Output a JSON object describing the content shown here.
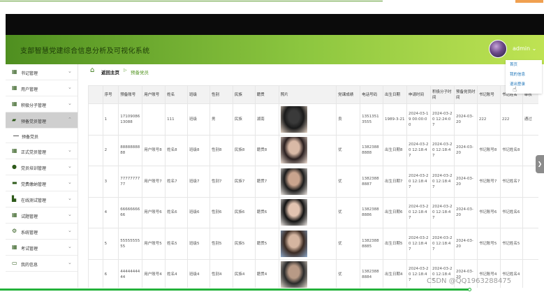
{
  "app": {
    "title": "支部智慧党建综合信息分析及可视化系统",
    "user": "admin ⌄"
  },
  "user_menu": [
    "首页",
    "我的信息",
    "退出登录"
  ],
  "sidebar": {
    "items": [
      {
        "label": "书记管理",
        "icon": "grid-icon"
      },
      {
        "label": "用户管理",
        "icon": "grid-icon"
      },
      {
        "label": "积极分子管理",
        "icon": "grid-icon"
      },
      {
        "label": "预备党员管理",
        "icon": "chat-icon",
        "active": true
      },
      {
        "label": "正式党员管理",
        "icon": "grid-icon"
      },
      {
        "label": "党员培训管理",
        "icon": "person-icon"
      },
      {
        "label": "党费缴纳管理",
        "icon": "monitor-icon"
      },
      {
        "label": "在线测试管理",
        "icon": "chart-icon"
      },
      {
        "label": "试题管理",
        "icon": "grid-icon"
      },
      {
        "label": "系统管理",
        "icon": "gear-icon"
      },
      {
        "label": "考试管理",
        "icon": "grid-icon"
      },
      {
        "label": "我的信息",
        "icon": "card-icon"
      }
    ],
    "submenu": "预备党员"
  },
  "breadcrumb": {
    "home": "返回主页",
    "current": "预备党员"
  },
  "table": {
    "headers": [
      "",
      "序号",
      "预备账号",
      "用户账号",
      "姓名",
      "班级",
      "性别",
      "民族",
      "籍贯",
      "照片",
      "党课成绩",
      "电话号码",
      "出生日期",
      "申请时间",
      "积极分子时间",
      "预备党员时间",
      "书记账号",
      "书记姓名",
      "审核"
    ],
    "rows": [
      [
        "",
        "1",
        "1710908613088",
        "",
        "111",
        "班级",
        "男",
        "民族",
        "湖南",
        "",
        "良",
        "13513513555",
        "1989-3-21",
        "2024-03-19 00:00:00",
        "2024-03-20 12:24:07",
        "2024-03-20",
        "222",
        "222",
        "通过"
      ],
      [
        "",
        "2",
        "8888888888",
        "用户账号8",
        "姓名8",
        "班级8",
        "性别8",
        "民族8",
        "籍贯8",
        "",
        "优",
        "13823888888",
        "出生日期8",
        "2024-03-20 12:18:47",
        "2024-03-20 12:18:47",
        "2024-03-20",
        "书记账号8",
        "书记姓名8",
        ""
      ],
      [
        "",
        "3",
        "7777777777",
        "用户账号7",
        "姓名7",
        "班级7",
        "性别7",
        "民族7",
        "籍贯7",
        "",
        "优",
        "13823888887",
        "出生日期7",
        "2024-03-20 12:18:47",
        "2024-03-20 12:18:47",
        "2024-03-20",
        "书记账号7",
        "书记姓名7",
        ""
      ],
      [
        "",
        "4",
        "6666666666",
        "用户账号6",
        "姓名6",
        "班级6",
        "性别6",
        "民族6",
        "籍贯6",
        "",
        "优",
        "13823888886",
        "出生日期6",
        "2024-03-20 12:18:47",
        "2024-03-20 12:18:47",
        "2024-03-20",
        "书记账号6",
        "书记姓名6",
        ""
      ],
      [
        "",
        "5",
        "5555555555",
        "用户账号5",
        "姓名5",
        "班级5",
        "性别5",
        "民族5",
        "籍贯5",
        "",
        "优",
        "13823888885",
        "出生日期5",
        "2024-03-20 12:18:47",
        "2024-03-20 12:18:47",
        "2024-03-20",
        "书记账号5",
        "书记姓名5",
        ""
      ],
      [
        "",
        "6",
        "4444444444",
        "用户账号4",
        "姓名4",
        "班级4",
        "性别4",
        "民族4",
        "籍贯4",
        "",
        "优",
        "13823888884",
        "出生日期4",
        "2024-03-20 12:18:47",
        "2024-03-20 12:18:47",
        "2024-03-20",
        "书记账号4",
        "书记姓名4",
        ""
      ]
    ]
  },
  "watermark": "CSDN @QQ1963288475",
  "colors": {
    "brand": "#5b9a2c",
    "accent_link": "#1c74b9",
    "progress": "#23b23a"
  }
}
